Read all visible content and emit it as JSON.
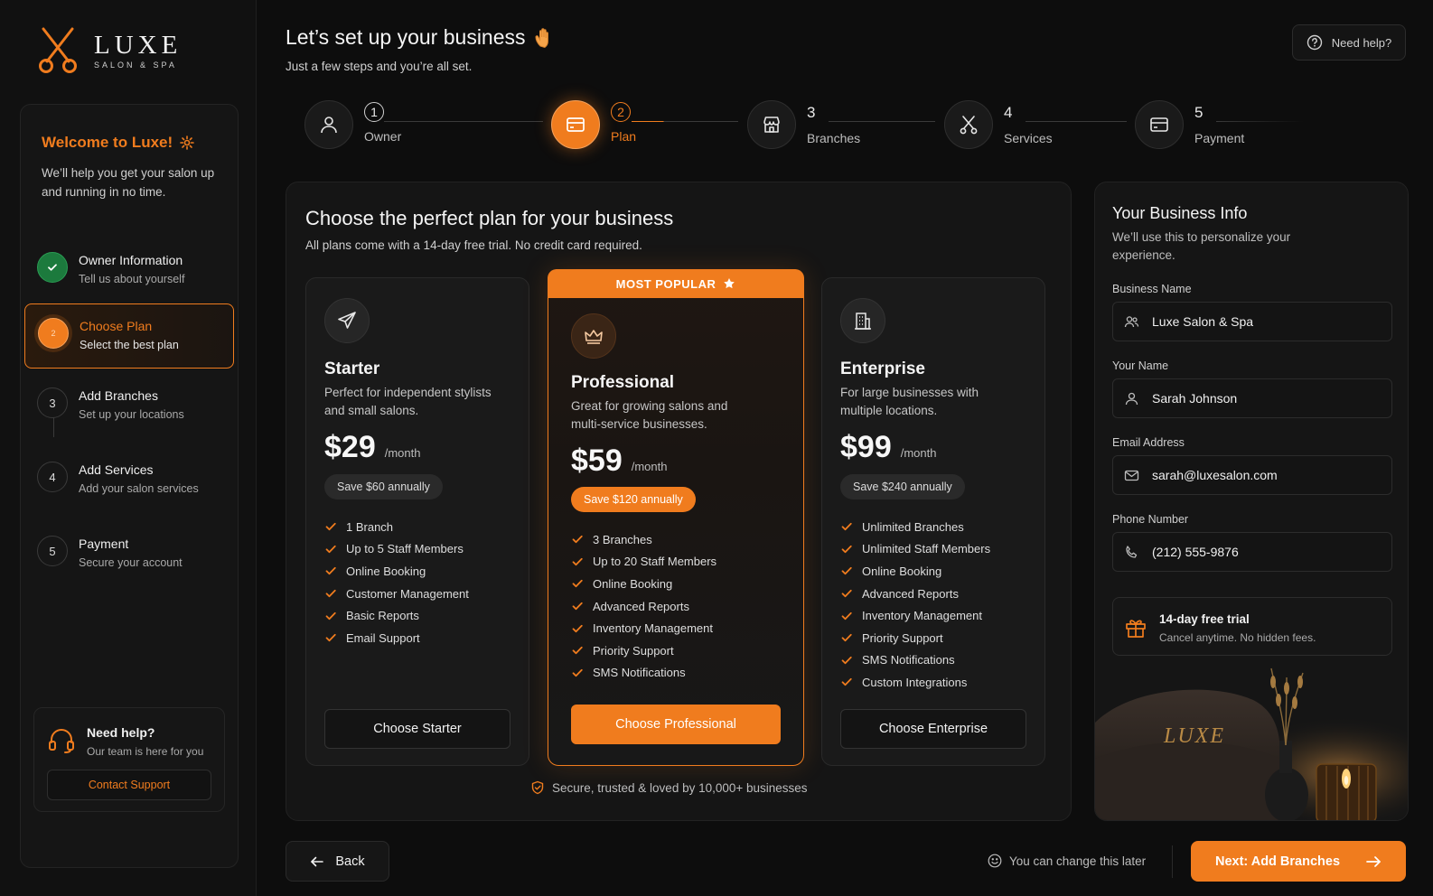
{
  "brand": {
    "name": "LUXE",
    "tagline": "SALON & SPA",
    "accent": "#f07c1e"
  },
  "header": {
    "title": "Let’s set up your business",
    "subtitle": "Just a few steps and you’re all set.",
    "help_label": "Need help?"
  },
  "sidebar": {
    "welcome_title": "Welcome to Luxe!",
    "welcome_desc": "We’ll help you get your salon up and running in no time.",
    "steps": [
      {
        "num": "✓",
        "title": "Owner Information",
        "subtitle": "Tell us about yourself",
        "state": "done"
      },
      {
        "num": "2",
        "title": "Choose Plan",
        "subtitle": "Select the best plan",
        "state": "active"
      },
      {
        "num": "3",
        "title": "Add Branches",
        "subtitle": "Set up your locations",
        "state": "todo"
      },
      {
        "num": "4",
        "title": "Add Services",
        "subtitle": "Add your salon services",
        "state": "todo"
      },
      {
        "num": "5",
        "title": "Payment",
        "subtitle": "Secure your account",
        "state": "todo"
      }
    ],
    "help": {
      "title": "Need help?",
      "subtitle": "Our team is here for you",
      "button": "Contact Support"
    }
  },
  "stepper": [
    {
      "num": "1",
      "label": "Owner",
      "icon": "user-icon"
    },
    {
      "num": "2",
      "label": "Plan",
      "icon": "card-icon"
    },
    {
      "num": "3",
      "label": "Branches",
      "icon": "store-icon"
    },
    {
      "num": "4",
      "label": "Services",
      "icon": "scissors-icon"
    },
    {
      "num": "5",
      "label": "Payment",
      "icon": "card-icon"
    }
  ],
  "plans_section": {
    "title": "Choose the perfect plan for your business",
    "subtitle": "All plans come with a 14-day free trial. No credit card required.",
    "popular_label": "MOST POPULAR",
    "trust_text": "Secure, trusted & loved by 10,000+ businesses",
    "plans": [
      {
        "name": "Starter",
        "desc": "Perfect for independent stylists and small salons.",
        "price": "$29",
        "period": "/month",
        "save": "Save $60 annually",
        "features": [
          "1 Branch",
          "Up to 5 Staff Members",
          "Online Booking",
          "Customer Management",
          "Basic Reports",
          "Email Support"
        ],
        "button": "Choose Starter"
      },
      {
        "name": "Professional",
        "desc": "Great for growing salons and multi-service businesses.",
        "price": "$59",
        "period": "/month",
        "save": "Save $120 annually",
        "features": [
          "3 Branches",
          "Up to 20 Staff Members",
          "Online Booking",
          "Advanced Reports",
          "Inventory Management",
          "Priority Support",
          "SMS Notifications"
        ],
        "button": "Choose Professional"
      },
      {
        "name": "Enterprise",
        "desc": "For large businesses with multiple locations.",
        "price": "$99",
        "period": "/month",
        "save": "Save $240 annually",
        "features": [
          "Unlimited Branches",
          "Unlimited Staff Members",
          "Online Booking",
          "Advanced Reports",
          "Inventory Management",
          "Priority Support",
          "SMS Notifications",
          "Custom Integrations"
        ],
        "button": "Choose Enterprise"
      }
    ]
  },
  "business_info": {
    "title": "Your Business Info",
    "subtitle": "We’ll use this to personalize your experience.",
    "fields": [
      {
        "label": "Business Name",
        "value": "Luxe Salon & Spa"
      },
      {
        "label": "Your Name",
        "value": "Sarah Johnson"
      },
      {
        "label": "Email Address",
        "value": "sarah@luxesalon.com"
      },
      {
        "label": "Phone Number",
        "value": "(212) 555-9876"
      }
    ],
    "trial_title": "14-day free trial",
    "trial_sub": "Cancel anytime. No hidden fees.",
    "photo_text": "LUXE"
  },
  "footer": {
    "back": "Back",
    "change_note": "You can change this later",
    "next": "Next: Add Branches"
  }
}
